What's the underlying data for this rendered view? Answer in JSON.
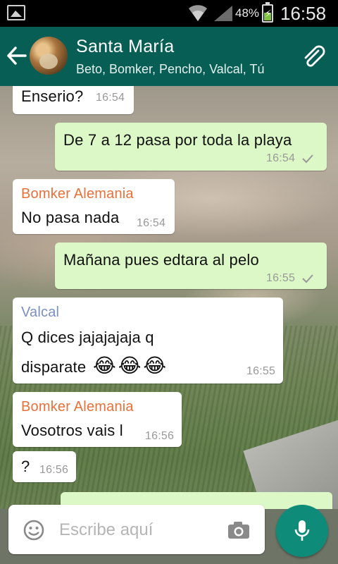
{
  "status": {
    "battery": "48%",
    "time": "16:58"
  },
  "header": {
    "title": "Santa María",
    "subtitle": "Beto, Bomker, Pencho, Valcal, Tú"
  },
  "messages": [
    {
      "type": "in",
      "text": "Enserio?",
      "time": "16:54"
    },
    {
      "type": "out",
      "text": "De 7 a 12 pasa por toda la playa",
      "time": "16:54"
    },
    {
      "type": "in",
      "sender": "Bomker Alemania",
      "text": "No pasa nada",
      "time": "16:54"
    },
    {
      "type": "out",
      "text": "Mañana pues edtara al pelo",
      "time": "16:55"
    },
    {
      "type": "in",
      "sender": "Valcal",
      "text_line1": "Q dices jajajajaja q",
      "text_line2": "disparate",
      "emojis": "😂😂😂",
      "time": "16:55"
    },
    {
      "type": "in",
      "sender": "Bomker Alemania",
      "text": "Vosotros vais l",
      "time": "16:56"
    },
    {
      "type": "in",
      "text": "?",
      "time": "16:56"
    }
  ],
  "input": {
    "placeholder": "Escribe aquí"
  },
  "colors": {
    "header": "#075e54",
    "outgoing": "#dcf8c6",
    "sender_bomker": "#e8703a",
    "sender_valcal": "#7b8fc4",
    "mic": "#0f8c79"
  }
}
